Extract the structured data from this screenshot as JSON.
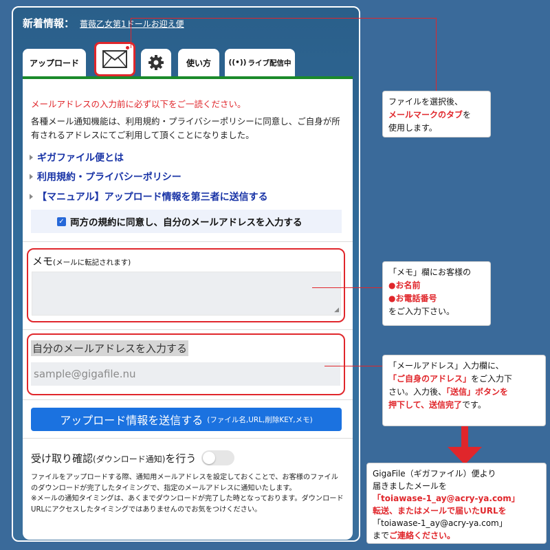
{
  "news": {
    "label": "新着情報：",
    "link": "薔薇乙女第1ドールお迎え便"
  },
  "tabs": {
    "upload": "アップロード",
    "howto": "使い方",
    "live": "ライブ配信中"
  },
  "card": {
    "notice": "メールアドレスの入力前に必ず以下をご一読ください。",
    "description": "各種メール通知機能は、利用規約・プライバシーポリシーに同意し、ご自身が所有されるアドレスにてご利用して頂くことになりました。",
    "links": [
      "ギガファイル便とは",
      "利用規約・プライバシーポリシー",
      "【マニュアル】アップロード情報を第三者に送信する"
    ],
    "agree_label": "両方の規約に同意し、自分のメールアドレスを入力する",
    "memo_label": "メモ",
    "memo_hint": "(メールに転記されます)",
    "email_label": "自分のメールアドレスを入力する",
    "email_placeholder": "sample@gigafile.nu",
    "send_label": "アップロード情報を送信する",
    "send_hint": "(ファイル名,URL,削除KEY,メモ)",
    "receipt_pre": "受け取り確認",
    "receipt_hint": "(ダウンロード通知)",
    "receipt_post": "を行う",
    "fineprint1": "ファイルをアップロードする際、通知用メールアドレスを設定しておくことで、お客様のファイルのダウンロードが完了したタイミングで、指定のメールアドレスに通知いたします。",
    "fineprint2": "※メールの通知タイミングは、あくまでダウンロードが完了した時となっております。ダウンロードURLにアクセスしたタイミングではありませんのでお気をつけください。"
  },
  "callouts": {
    "c1": {
      "l1": "ファイルを選択後、",
      "l2_red": "メールマークのタブ",
      "l2_tail": "を",
      "l3": "使用します。"
    },
    "c2": {
      "l1": "「メモ」欄にお客様の",
      "l2": "●お名前",
      "l3": "●お電話番号",
      "l4": "をご入力下さい。"
    },
    "c3": {
      "l1": "「メールアドレス」入力欄に、",
      "l2_red": "「ご自身のアドレス」",
      "l2_tail": "をご入力下",
      "l3_a": "さい。入力後、",
      "l3_red": "「送信」ボタンを",
      "l4_red": "押下して、送信完了",
      "l4_tail": "です。"
    },
    "c4": {
      "l1": "GigaFile（ギガファイル）便より",
      "l2": "届きましたメールを",
      "l3_red": "「toiawase-1_ay@acry-ya.com」",
      "l4_red": "転送、またはメールで届いたURLを",
      "l5": "「toiawase-1_ay@acry-ya.com」",
      "l6_a": "まで",
      "l6_red": "ご連絡ください。"
    }
  }
}
